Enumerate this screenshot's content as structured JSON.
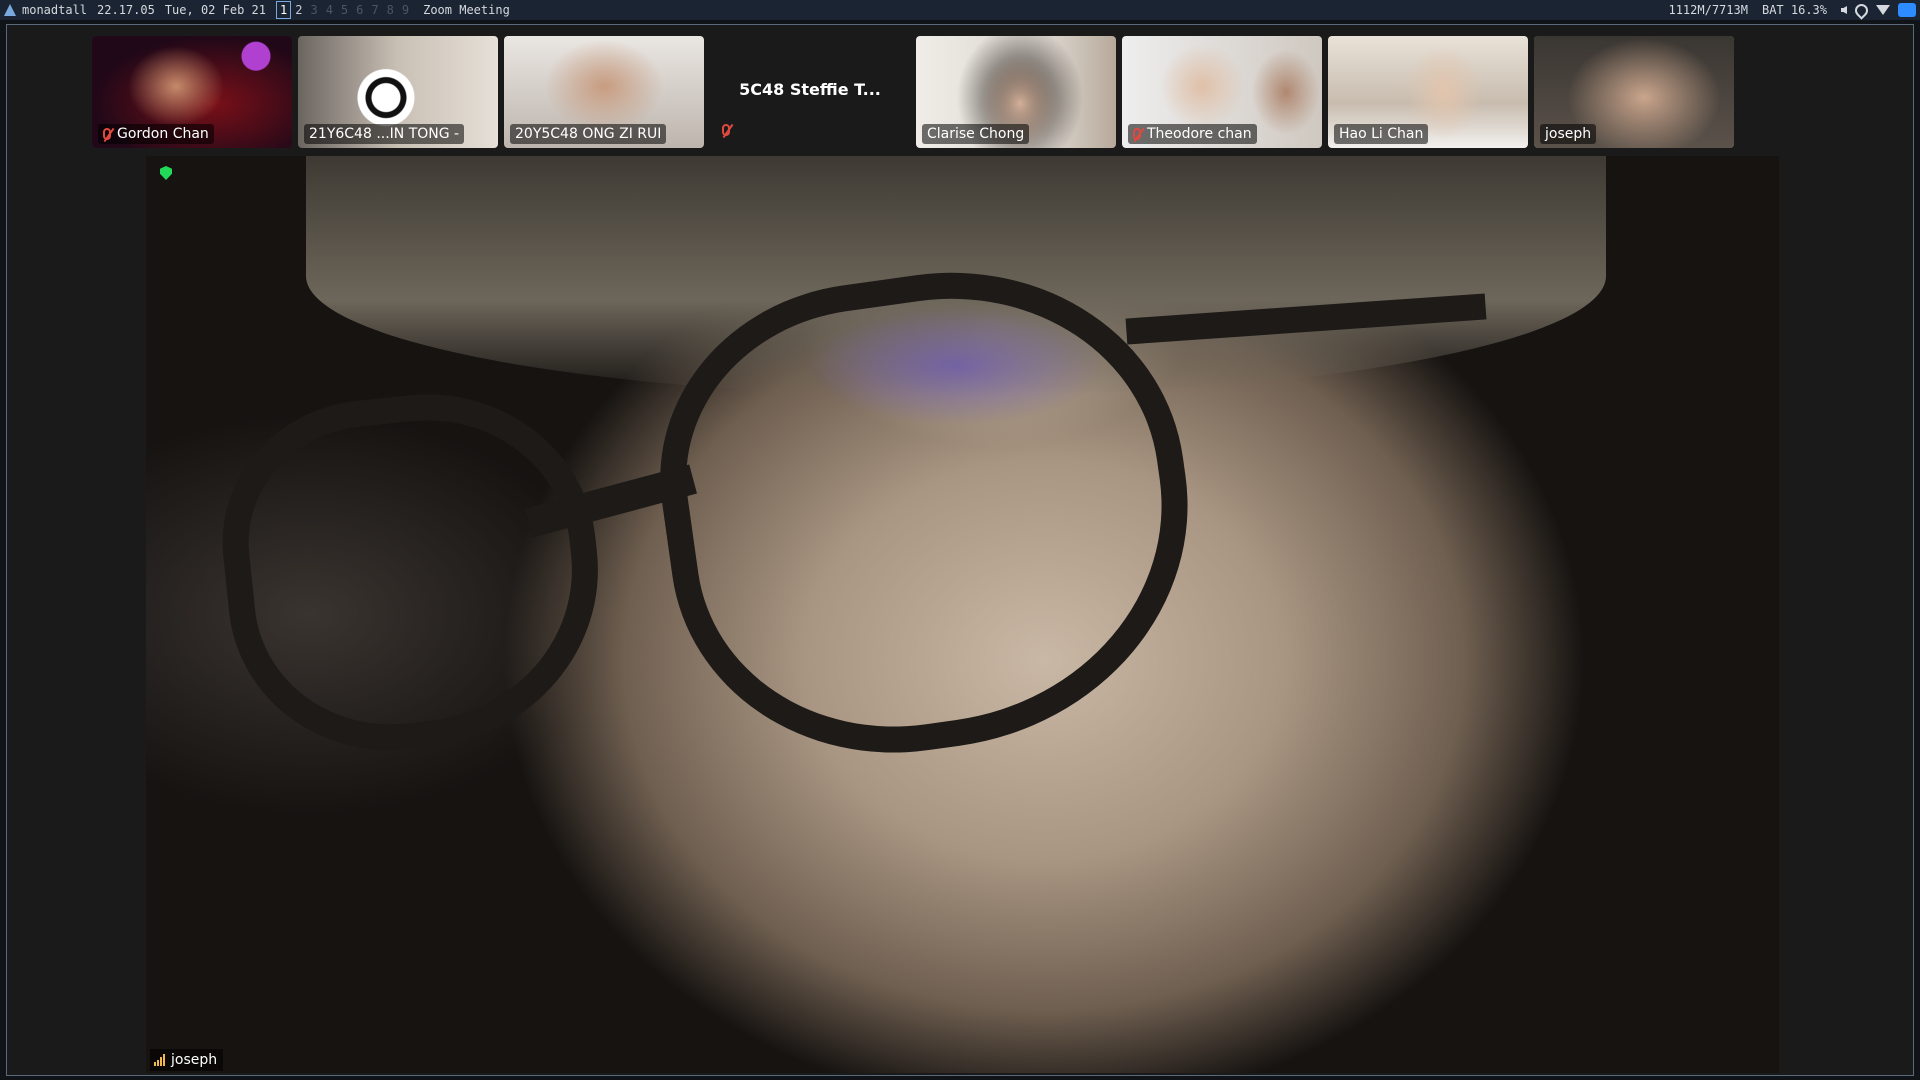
{
  "topbar": {
    "wm_name": "monadtall",
    "time": "22.17.05",
    "date": "Tue, 02 Feb 21",
    "workspaces": [
      "1",
      "2",
      "3",
      "4",
      "5",
      "6",
      "7",
      "8",
      "9"
    ],
    "active_workspace": "1",
    "window_title": "Zoom Meeting",
    "memory": "1112M/7713M",
    "battery": "BAT 16.3%",
    "tray_icons": [
      "volume-icon",
      "location-icon",
      "wifi-icon",
      "zoom-tray-icon"
    ]
  },
  "participants": [
    {
      "name": "Gordon Chan",
      "muted": true
    },
    {
      "name": "21Y6C48 ...IN TONG -",
      "muted": false
    },
    {
      "name": "20Y5C48 ONG ZI RUI",
      "muted": false
    },
    {
      "name": "5C48 Steffie T...",
      "muted": true,
      "video_off": true
    },
    {
      "name": "Clarise Chong",
      "muted": false
    },
    {
      "name": "Theodore chan",
      "muted": true
    },
    {
      "name": "Hao Li Chan",
      "muted": false
    },
    {
      "name": "joseph",
      "muted": false,
      "speaking": true
    }
  ],
  "active_speaker": {
    "name": "joseph",
    "accent": "#23d959"
  },
  "colors": {
    "speaking_border": "#23d959",
    "mute_red": "#e0493f",
    "topbar_bg": "#1b2433"
  }
}
